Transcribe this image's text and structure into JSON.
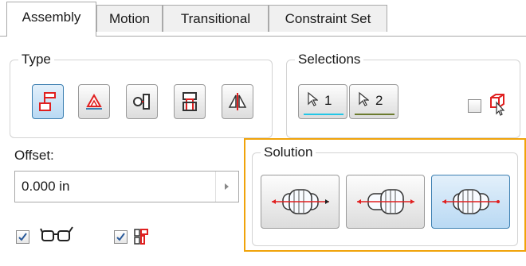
{
  "tabs": [
    {
      "label": "Assembly"
    },
    {
      "label": "Motion"
    },
    {
      "label": "Transitional"
    },
    {
      "label": "Constraint Set"
    }
  ],
  "type_group": {
    "legend": "Type",
    "buttons": [
      "mate-constraint-icon",
      "angle-constraint-icon",
      "tangent-constraint-icon",
      "insert-constraint-icon",
      "symmetry-constraint-icon"
    ]
  },
  "selections_group": {
    "legend": "Selections",
    "first_label": "1",
    "second_label": "2",
    "first_underline_color": "#22c6e6",
    "second_underline_color": "#6b7a2e",
    "pick_part_first_checked": false
  },
  "offset": {
    "label": "Offset:",
    "value": "0.000 in"
  },
  "preview_checkbox": {
    "checked": true,
    "icon": "glasses-icon"
  },
  "predict_offset_checkbox": {
    "checked": true,
    "icon": "predict-offset-icon"
  },
  "solution_group": {
    "legend": "Solution",
    "buttons": [
      "mate-solution-icon",
      "flush-solution-icon",
      "undirected-solution-icon"
    ],
    "selected_index": 2
  },
  "colors": {
    "accent_blue": "#3c7fb1",
    "selected_fill": "#b9d9f3",
    "highlight_orange": "#f0a30a",
    "constraint_red": "#e02020"
  }
}
